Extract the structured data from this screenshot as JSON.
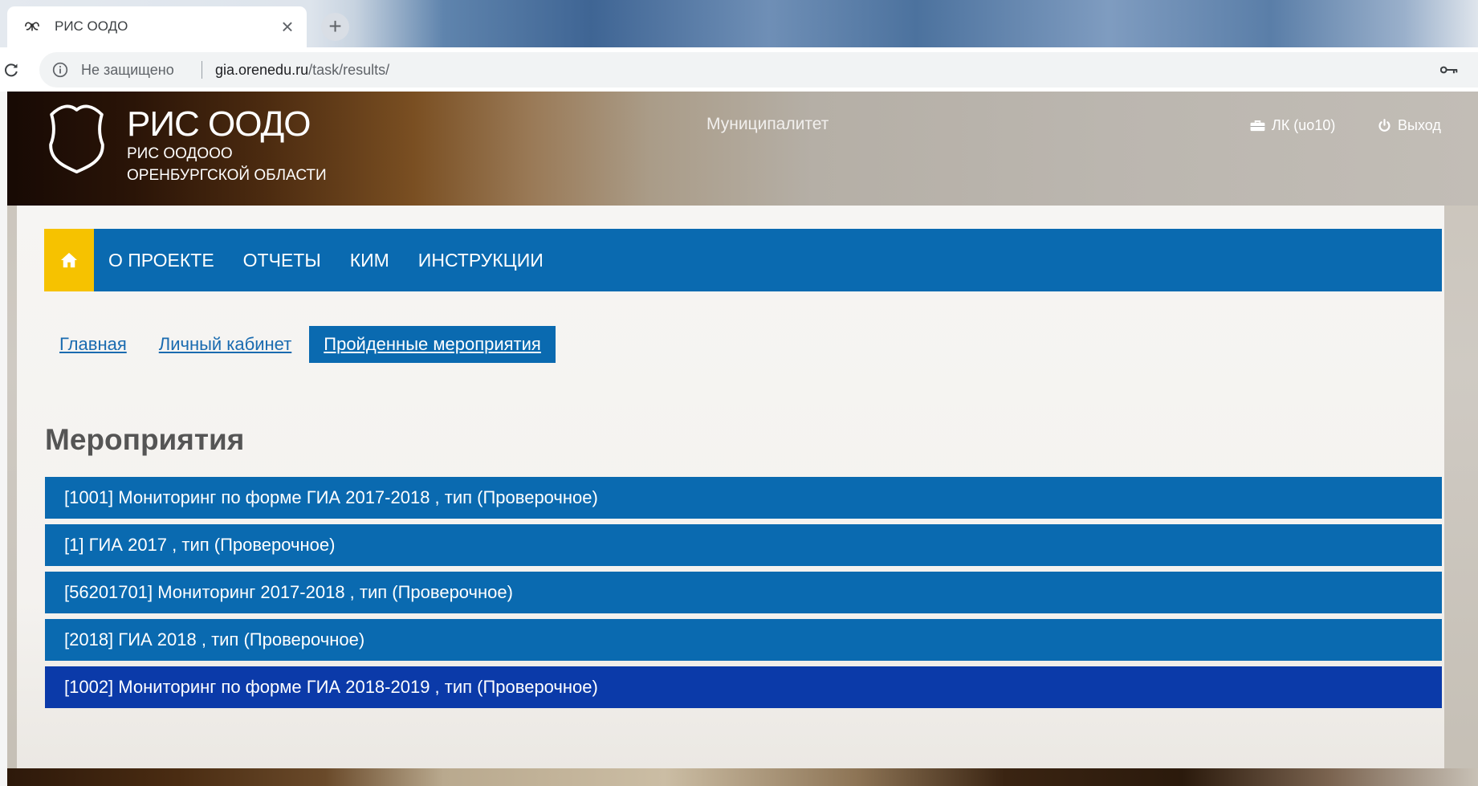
{
  "browser": {
    "tab_title": "РИС ООДО",
    "tab_close": "×",
    "new_tab": "+",
    "security_label": "Не защищено",
    "url_host": "gia.orenedu.ru",
    "url_path": "/task/results/"
  },
  "header": {
    "logo_title": "РИС ООДО",
    "logo_line_1": "РИС ООДООО",
    "logo_line_2": "ОРЕНБУРГСКОЙ ОБЛАСТИ",
    "role_label": "Муниципалитет",
    "account_label": "ЛК (uo10)",
    "logout_label": "Выход"
  },
  "nav": {
    "items": [
      {
        "label": "О ПРОЕКТЕ"
      },
      {
        "label": "ОТЧЕТЫ"
      },
      {
        "label": "КИМ"
      },
      {
        "label": "ИНСТРУКЦИИ"
      }
    ]
  },
  "breadcrumbs": [
    {
      "label": "Главная",
      "active": false
    },
    {
      "label": "Личный кабинет",
      "active": false
    },
    {
      "label": "Пройденные мероприятия",
      "active": true
    }
  ],
  "section_title": "Мероприятия",
  "events": [
    {
      "label": "[1001] Мониторинг по форме ГИА 2017-2018 , тип (Проверочное)",
      "selected": false
    },
    {
      "label": "[1] ГИА 2017 , тип (Проверочное)",
      "selected": false
    },
    {
      "label": "[56201701] Мониторинг 2017-2018 , тип (Проверочное)",
      "selected": false
    },
    {
      "label": "[2018] ГИА 2018 , тип (Проверочное)",
      "selected": false
    },
    {
      "label": "[1002] Мониторинг по форме ГИА 2018-2019 , тип (Проверочное)",
      "selected": true
    }
  ],
  "icons": {
    "favicon": "site-favicon-icon",
    "reload": "reload-icon",
    "info": "info-icon",
    "key": "key-icon",
    "logo": "shield-logo-icon",
    "account": "briefcase-icon",
    "logout": "power-icon",
    "home": "home-icon"
  },
  "colors": {
    "nav_blue": "#0a6ab0",
    "home_yellow": "#f6c200",
    "selected_blue": "#0b3aa9",
    "heading_gray": "#555555",
    "link_blue": "#1a6bb0"
  }
}
